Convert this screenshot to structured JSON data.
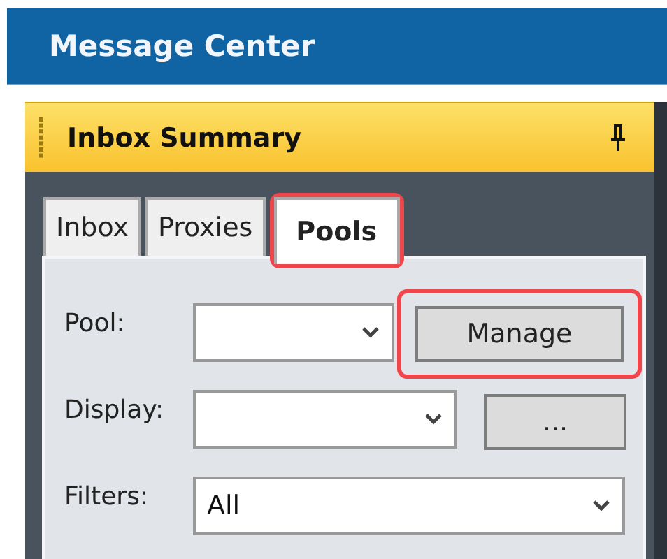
{
  "header": {
    "title": "Message Center"
  },
  "panel": {
    "title": "Inbox Summary"
  },
  "tabs": [
    {
      "label": "Inbox",
      "selected": false,
      "highlighted": false
    },
    {
      "label": "Proxies",
      "selected": false,
      "highlighted": false
    },
    {
      "label": "Pools",
      "selected": true,
      "highlighted": true
    }
  ],
  "fields": [
    {
      "label": "Pool:",
      "button": "Manage",
      "button_highlighted": true
    },
    {
      "label": "Display:",
      "button": "..."
    },
    {
      "label": "Filters:",
      "value": "All"
    }
  ]
}
